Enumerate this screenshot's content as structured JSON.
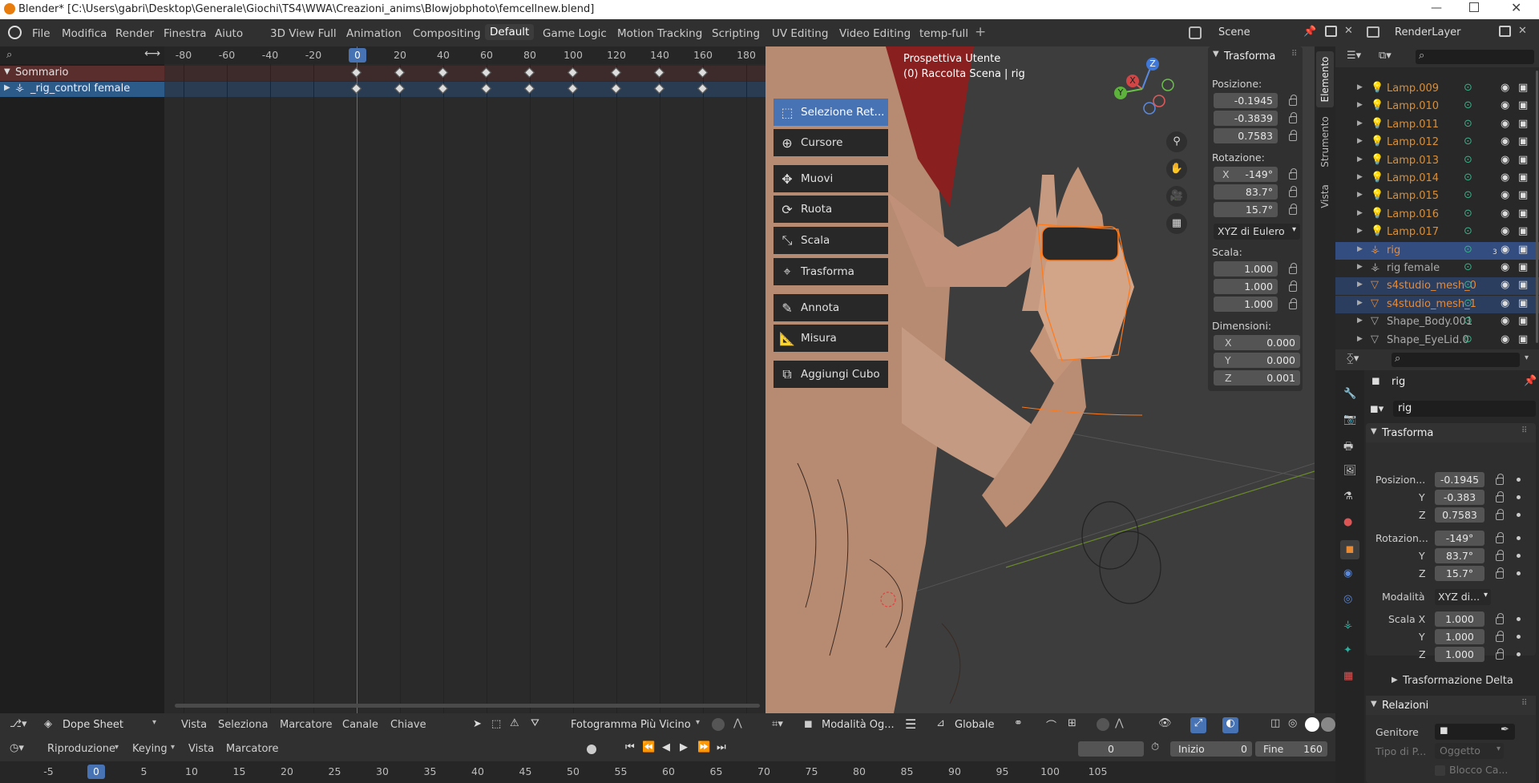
{
  "title_bar": {
    "text": "Blender* [C:\\Users\\gabri\\Desktop\\Generale\\Giochi\\TS4\\WWA\\Creazioni_anims\\Blowjobphoto\\femcellnew.blend]"
  },
  "menu": {
    "items": [
      "File",
      "Modifica",
      "Render",
      "Finestra",
      "Aiuto"
    ]
  },
  "workspaces": [
    "3D View Full",
    "Animation",
    "Compositing",
    "Default",
    "Game Logic",
    "Motion Tracking",
    "Scripting",
    "UV Editing",
    "Video Editing",
    "temp-full"
  ],
  "active_workspace": "Default",
  "scene": {
    "label": "Scene",
    "render_layer": "RenderLayer"
  },
  "dopesheet": {
    "ruler": [
      "-80",
      "-60",
      "-40",
      "-20",
      "0",
      "20",
      "40",
      "60",
      "80",
      "100",
      "120",
      "140",
      "160",
      "180"
    ],
    "current_frame": "0",
    "channels": [
      {
        "label": "Sommario"
      },
      {
        "label": "_rig_control female"
      }
    ],
    "header": {
      "editor": "Dope Sheet",
      "menus": [
        "Vista",
        "Seleziona",
        "Marcatore",
        "Canale",
        "Chiave"
      ],
      "snap": "Fotogramma Più Vicino"
    }
  },
  "viewport": {
    "view_name": "Prospettiva Utente",
    "collection": "(0) Raccolta Scena | rig",
    "tools": [
      "Selezione Ret...",
      "Cursore",
      "Muovi",
      "Ruota",
      "Scala",
      "Trasforma",
      "Annota",
      "Misura",
      "Aggiungi Cubo"
    ],
    "header": {
      "mode": "Modalità Og...",
      "orientation": "Globale"
    },
    "gizmo_axes": {
      "z": "Z",
      "x": "X",
      "y": "Y"
    }
  },
  "n_panel": {
    "title": "Trasforma",
    "tabs": [
      "Elemento",
      "Strumento",
      "Vista"
    ],
    "position_label": "Posizione:",
    "position": [
      "-0.1945",
      "-0.3839",
      "0.7583"
    ],
    "rotation_label": "Rotazione:",
    "rotation_x_axis": "X",
    "rotation": [
      "-149°",
      "83.7°",
      "15.7°"
    ],
    "rotation_mode": "XYZ di Eulero",
    "scale_label": "Scala:",
    "scale": [
      "1.000",
      "1.000",
      "1.000"
    ],
    "dimensions_label": "Dimensioni:",
    "dimensions": [
      {
        "axis": "X",
        "value": "0.000"
      },
      {
        "axis": "Y",
        "value": "0.000"
      },
      {
        "axis": "Z",
        "value": "0.001"
      }
    ]
  },
  "outliner": {
    "items": [
      {
        "name": "Lamp.009",
        "color": "#d88f3a"
      },
      {
        "name": "Lamp.010",
        "color": "#d88f3a"
      },
      {
        "name": "Lamp.011",
        "color": "#d88f3a"
      },
      {
        "name": "Lamp.012",
        "color": "#d88f3a"
      },
      {
        "name": "Lamp.013",
        "color": "#d88f3a"
      },
      {
        "name": "Lamp.014",
        "color": "#d88f3a"
      },
      {
        "name": "Lamp.015",
        "color": "#d88f3a"
      },
      {
        "name": "Lamp.016",
        "color": "#d88f3a"
      },
      {
        "name": "Lamp.017",
        "color": "#d88f3a"
      },
      {
        "name": "rig",
        "color": "#e78a33"
      },
      {
        "name": "rig female",
        "color": "#aaaaaa"
      },
      {
        "name": "s4studio_mesh_0",
        "color": "#e78a33"
      },
      {
        "name": "s4studio_mesh_1",
        "color": "#e78a33"
      },
      {
        "name": "Shape_Body.001",
        "color": "#aaaaaa"
      },
      {
        "name": "Shape_EyeLid.0",
        "color": "#aaaaaa"
      }
    ],
    "rig_badge": "3"
  },
  "properties": {
    "object": "rig",
    "object_field": "rig",
    "section_transform": "Trasforma",
    "pos_label": "Posizion...",
    "position": [
      "-0.1945",
      "-0.383",
      "0.7583"
    ],
    "rot_label": "Rotazion...",
    "rotation": [
      "-149°",
      "83.7°",
      "15.7°"
    ],
    "mode_label": "Modalità",
    "mode_value": "XYZ di...",
    "scale_label": "Scala X",
    "scale": [
      "1.000",
      "1.000",
      "1.000"
    ],
    "axis_y": "Y",
    "axis_z": "Z",
    "delta": "Trasformazione Delta",
    "section_relations": "Relazioni",
    "parent_label": "Genitore",
    "parent_type_label": "Tipo di P...",
    "parent_type_value": "Oggetto",
    "parent_lock_label": "Blocco Ca..."
  },
  "timeline": {
    "menus": [
      "Riproduzione",
      "Keying",
      "Vista",
      "Marcatore"
    ],
    "current": "0",
    "start_label": "Inizio",
    "start": "0",
    "end_label": "Fine",
    "end": "160",
    "ruler": [
      "-5",
      "0",
      "5",
      "10",
      "15",
      "20",
      "25",
      "30",
      "35",
      "40",
      "45",
      "50",
      "55",
      "60",
      "65",
      "70",
      "75",
      "80",
      "85",
      "90",
      "95",
      "100",
      "105"
    ]
  }
}
